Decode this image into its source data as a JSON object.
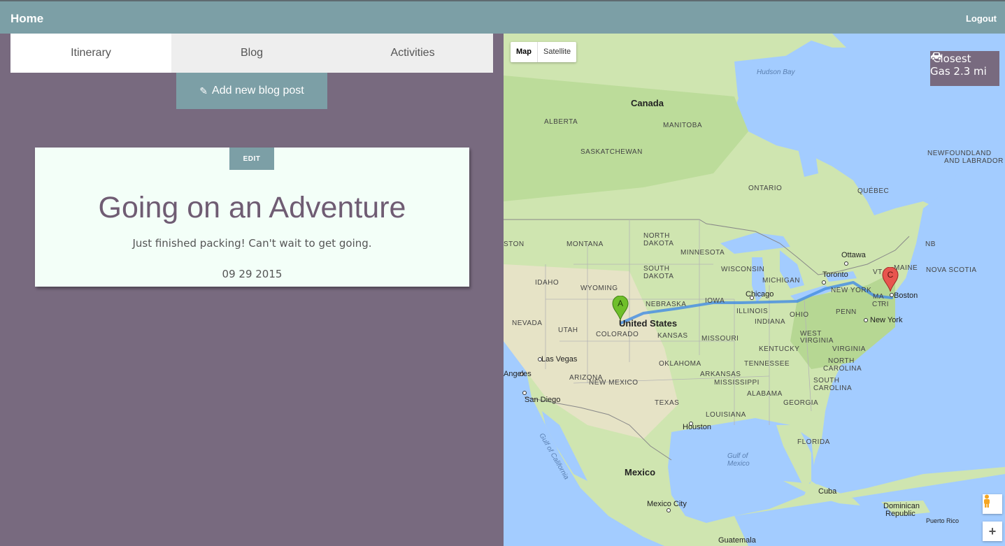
{
  "nav": {
    "brand": "Home",
    "logout": "Logout"
  },
  "tabs": [
    {
      "label": "Itinerary",
      "active": true
    },
    {
      "label": "Blog",
      "active": false
    },
    {
      "label": "Activities",
      "active": false
    }
  ],
  "add_post": {
    "label": "Add new blog post",
    "icon": "pencil-icon"
  },
  "post": {
    "edit_label": "EDIT",
    "title": "Going on an Adventure",
    "body": "Just finished packing! Can't wait to get going.",
    "date": "09 29 2015"
  },
  "map": {
    "type_map": "Map",
    "type_satellite": "Satellite",
    "gas_line1": "Closest",
    "gas_line2": "Gas 2.3 mi",
    "gas_icon": "car-icon",
    "zoom_in": "+",
    "marker_a": "A",
    "marker_c": "C",
    "labels": {
      "canada": "Canada",
      "hudson_bay": "Hudson Bay",
      "alberta": "ALBERTA",
      "manitoba": "MANITOBA",
      "saskatchewan": "SASKATCHEWAN",
      "ontario": "ONTARIO",
      "quebec": "QUÉBEC",
      "newfoundland": "NEWFOUNDLAND",
      "and_labrador": "AND LABRADOR",
      "ston": "STON",
      "montana": "MONTANA",
      "north": "NORTH",
      "dakota": "DAKOTA",
      "minnesota": "MINNESOTA",
      "ottawa": "Ottawa",
      "nb": "NB",
      "maine": "MAINE",
      "nova_scotia": "NOVA SCOTIA",
      "south": "SOUTH",
      "dakota2": "DAKOTA",
      "wisconsin": "WISCONSIN",
      "toronto": "Toronto",
      "vt": "VT",
      "idaho": "IDAHO",
      "wyoming": "WYOMING",
      "michigan": "MICHIGAN",
      "new_york_state": "NEW YORK",
      "ma": "MA",
      "boston": "Boston",
      "ct": "CT",
      "ri": "RI",
      "nebraska": "NEBRASKA",
      "iowa": "IOWA",
      "chicago": "Chicago",
      "nevada": "NEVADA",
      "utah": "UTAH",
      "united_states": "United States",
      "illinois": "ILLINOIS",
      "indiana": "INDIANA",
      "ohio": "OHIO",
      "penn": "PENN",
      "new_york_city": "New York",
      "colorado": "COLORADO",
      "kansas": "KANSAS",
      "missouri": "MISSOURI",
      "west": "WEST",
      "virginia": "VIRGINIA",
      "kentucky": "KENTUCKY",
      "virginia2": "VIRGINIA",
      "las_vegas": "Las Vegas",
      "oklahoma": "OKLAHOMA",
      "tennessee": "TENNESSEE",
      "north2": "NORTH",
      "carolina": "CAROLINA",
      "angeles": "Angeles",
      "arizona": "ARIZONA",
      "new_mexico": "NEW MEXICO",
      "arkansas": "ARKANSAS",
      "mississippi": "MISSISSIPPI",
      "south2": "SOUTH",
      "carolina2": "CAROLINA",
      "san_diego": "San Diego",
      "texas": "TEXAS",
      "alabama": "ALABAMA",
      "georgia": "GEORGIA",
      "louisiana": "LOUISIANA",
      "houston": "Houston",
      "gulf_of_california": "Gulf of California",
      "florida": "FLORIDA",
      "gulf_of": "Gulf of",
      "mexico_water": "Mexico",
      "mexico": "Mexico",
      "cuba": "Cuba",
      "mexico_city": "Mexico City",
      "dominican": "Dominican",
      "republic": "Republic",
      "puerto_rico": "Puerto Rico",
      "guatemala": "Guatemala"
    }
  },
  "colors": {
    "nav": "#7c9fa6",
    "panel": "#786a7f",
    "card": "#f3fff8",
    "title": "#6f5c73",
    "route": "#4a90e2",
    "marker_a": "#6fbf2a",
    "marker_c": "#e8554e"
  }
}
